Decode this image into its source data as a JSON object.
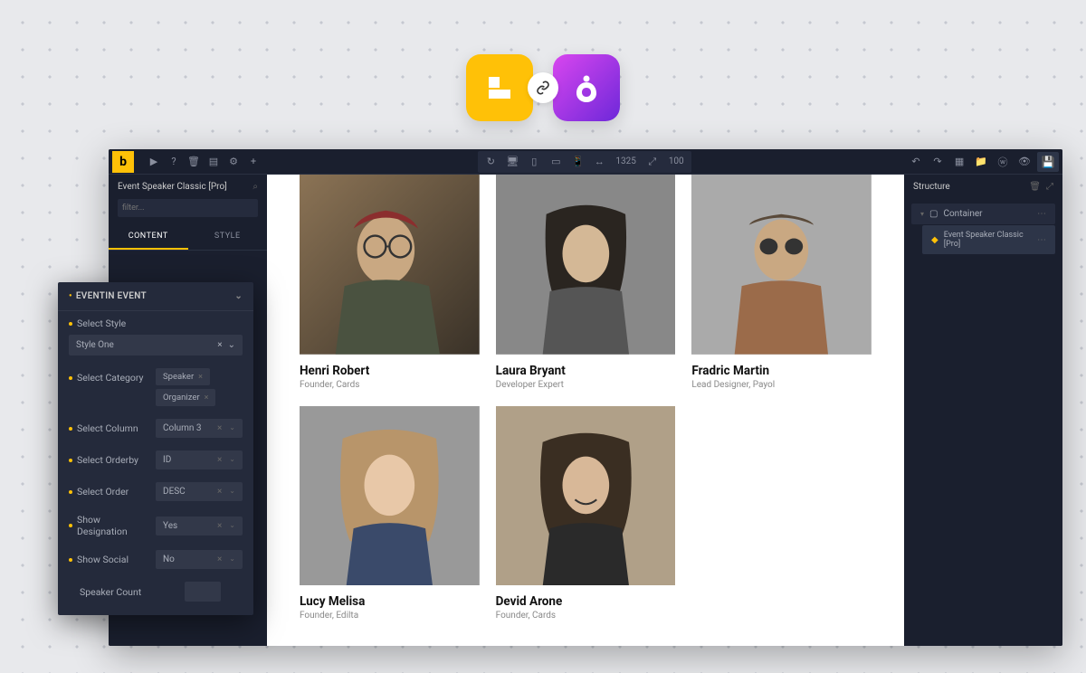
{
  "header": {
    "link_icon": "link"
  },
  "left_panel": {
    "title": "Event Speaker Classic [Pro]",
    "search_placeholder": "filter...",
    "tabs": {
      "content": "CONTENT",
      "style": "STYLE"
    }
  },
  "toolbar": {
    "width": "1325",
    "scale": "100"
  },
  "right_panel": {
    "title": "Structure",
    "items": [
      {
        "label": "Container",
        "icon": "container"
      },
      {
        "label": "Event Speaker Classic [Pro]",
        "icon": "widget"
      }
    ]
  },
  "settings": {
    "accordion_title": "EVENTIN EVENT",
    "style_label": "Select Style",
    "style_value": "Style One",
    "category_label": "Select Category",
    "category_tags": [
      "Speaker",
      "Organizer"
    ],
    "column_label": "Select Column",
    "column_value": "Column 3",
    "orderby_label": "Select Orderby",
    "orderby_value": "ID",
    "order_label": "Select Order",
    "order_value": "DESC",
    "designation_label": "Show Designation",
    "designation_value": "Yes",
    "social_label": "Show Social",
    "social_value": "No",
    "count_label": "Speaker Count"
  },
  "speakers": [
    {
      "name": "Henri Robert",
      "role": "Founder, Cards"
    },
    {
      "name": "Laura Bryant",
      "role": "Developer Expert"
    },
    {
      "name": "Fradric Martin",
      "role": "Lead Designer, Payol"
    },
    {
      "name": "Lucy Melisa",
      "role": "Founder, Edilta"
    },
    {
      "name": "Devid Arone",
      "role": "Founder, Cards"
    }
  ]
}
